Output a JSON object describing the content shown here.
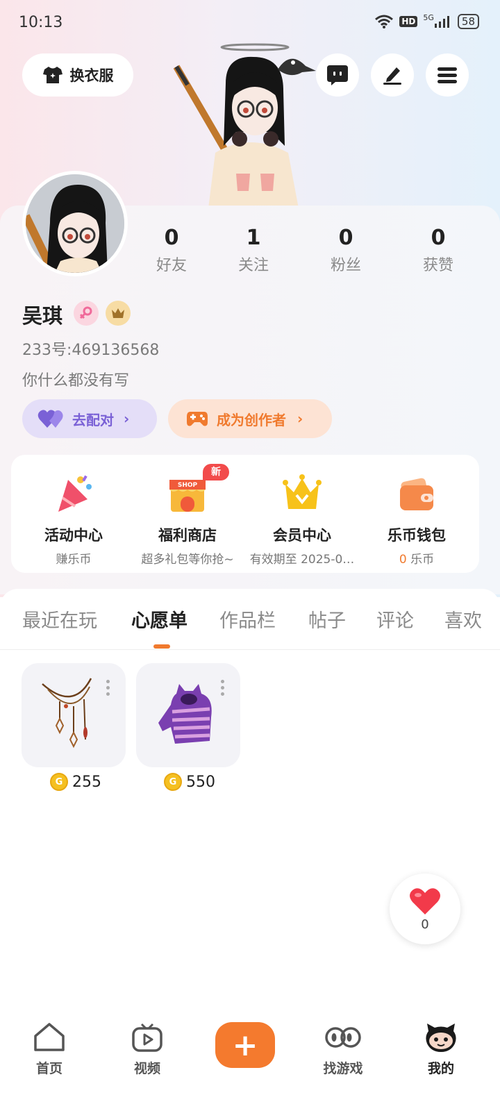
{
  "status_bar": {
    "time": "10:13",
    "network": "5G",
    "hd": "HD",
    "battery": "58"
  },
  "top": {
    "outfit_label": "换衣服"
  },
  "stats": [
    {
      "num": "0",
      "label": "好友"
    },
    {
      "num": "1",
      "label": "关注"
    },
    {
      "num": "0",
      "label": "粉丝"
    },
    {
      "num": "0",
      "label": "获赞"
    }
  ],
  "profile": {
    "name": "吴琪",
    "uid": "233号:469136568",
    "bio": "你什么都没有写",
    "pair_label": "去配对",
    "creator_label": "成为创作者"
  },
  "features": [
    {
      "title": "活动中心",
      "sub": "赚乐币"
    },
    {
      "title": "福利商店",
      "sub": "超多礼包等你抢~",
      "badge": "新",
      "shop": "SHOP"
    },
    {
      "title": "会员中心",
      "sub": "有效期至 2025-0…"
    },
    {
      "title": "乐币钱包",
      "sub_num": "0",
      "sub_unit": "乐币"
    }
  ],
  "tabs": [
    "最近在玩",
    "心愿单",
    "作品栏",
    "帖子",
    "评论",
    "喜欢"
  ],
  "active_tab": "心愿单",
  "wishlist": [
    {
      "name": "necklace",
      "price": "255"
    },
    {
      "name": "hoodie",
      "price": "550"
    }
  ],
  "like": {
    "count": "0"
  },
  "nav": {
    "home": "首页",
    "video": "视频",
    "games": "找游戏",
    "mine": "我的",
    "create": "+"
  },
  "colors": {
    "accent": "#f47a2e",
    "purple": "#7a61d6",
    "coin": "#f5c021"
  }
}
